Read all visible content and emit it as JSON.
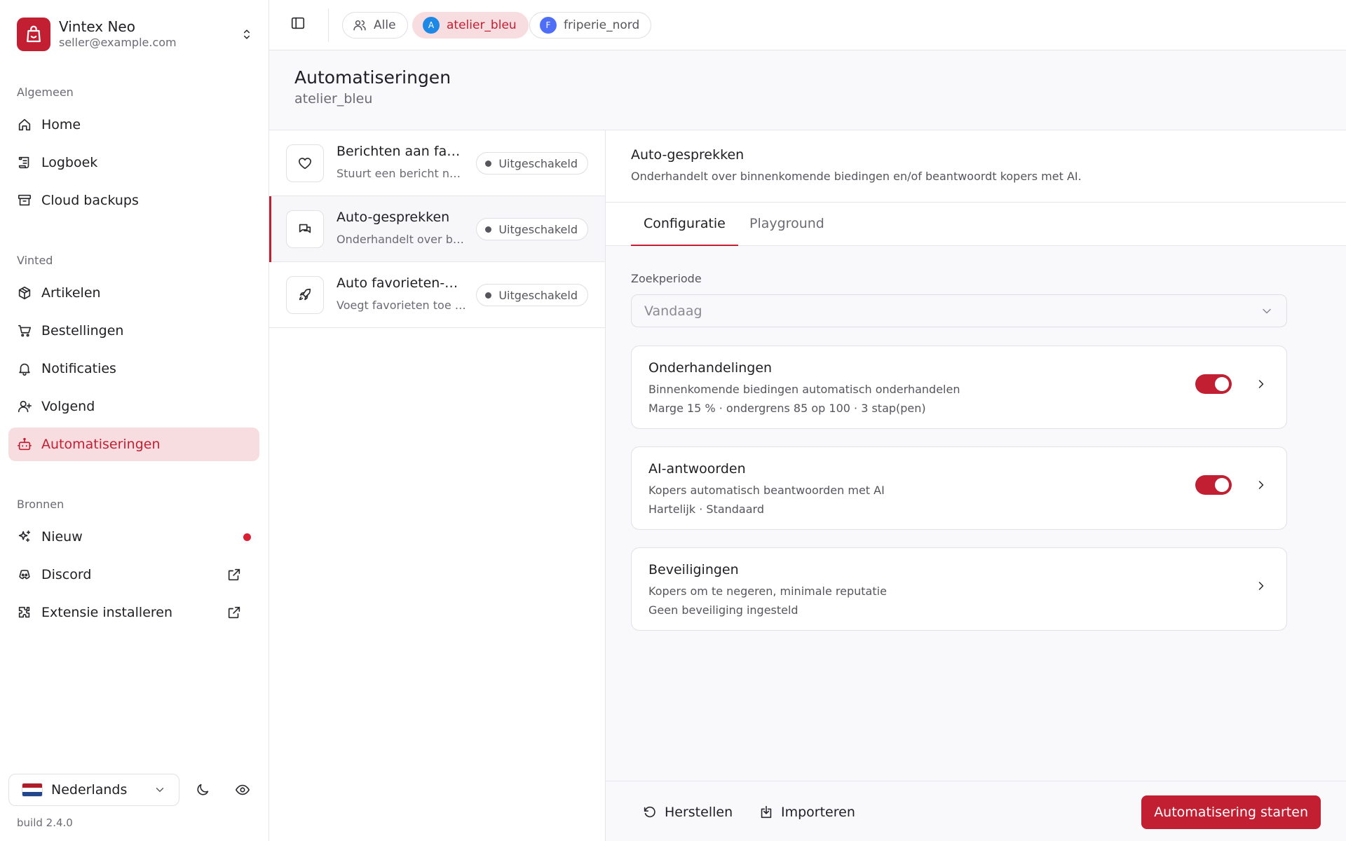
{
  "user": {
    "name": "Vintex Neo",
    "email": "seller@example.com"
  },
  "sidebar": {
    "sections": [
      {
        "title": "Algemeen",
        "items": [
          {
            "label": "Home"
          },
          {
            "label": "Logboek"
          },
          {
            "label": "Cloud backups"
          }
        ]
      },
      {
        "title": "Vinted",
        "items": [
          {
            "label": "Artikelen"
          },
          {
            "label": "Bestellingen"
          },
          {
            "label": "Notificaties"
          },
          {
            "label": "Volgend"
          },
          {
            "label": "Automatiseringen"
          }
        ]
      },
      {
        "title": "Bronnen",
        "items": [
          {
            "label": "Nieuw"
          },
          {
            "label": "Discord"
          },
          {
            "label": "Extensie installeren"
          }
        ]
      }
    ],
    "active_item": "Automatiseringen",
    "language": "Nederlands",
    "build": "build 2.4.0"
  },
  "topbar": {
    "chips": [
      {
        "label": "Alle"
      },
      {
        "label": "atelier_bleu",
        "avatar": "A",
        "avatar_color": "#1e88e5",
        "active": true
      },
      {
        "label": "friperie_nord",
        "avatar": "F",
        "avatar_color": "#4f6ef7"
      }
    ]
  },
  "header": {
    "title": "Automatiseringen",
    "subtitle": "atelier_bleu"
  },
  "automations": [
    {
      "title": "Berichten aan favorieten",
      "desc": "Stuurt een bericht naar gebruikers die een artikel favoriet maken",
      "status": "Uitgeschakeld",
      "icon": "heart-icon"
    },
    {
      "title": "Auto-gesprekken",
      "desc": "Onderhandelt over binnenkomende biedingen",
      "status": "Uitgeschakeld",
      "icon": "chat-icon",
      "selected": true
    },
    {
      "title": "Auto favorieten-boost",
      "desc": "Voegt favorieten toe aan artikelen",
      "status": "Uitgeschakeld",
      "icon": "rocket-icon"
    }
  ],
  "detail": {
    "title": "Auto-gesprekken",
    "desc": "Onderhandelt over binnenkomende biedingen en/of beantwoordt kopers met AI.",
    "tabs": [
      {
        "label": "Configuratie",
        "active": true
      },
      {
        "label": "Playground"
      }
    ],
    "period_label": "Zoekperiode",
    "period_value": "Vandaag",
    "cards": [
      {
        "title": "Onderhandelingen",
        "desc": "Binnenkomende biedingen automatisch onderhandelen",
        "meta": "Marge 15 % · ondergrens 85 op 100 · 3 stap(pen)",
        "enabled": true
      },
      {
        "title": "AI-antwoorden",
        "desc": "Kopers automatisch beantwoorden met AI",
        "meta": "Hartelijk · Standaard",
        "enabled": true
      },
      {
        "title": "Beveiligingen",
        "desc": "Kopers om te negeren, minimale reputatie",
        "meta": "Geen beveiliging ingesteld"
      }
    ]
  },
  "footer": {
    "reset_label": "Herstellen",
    "import_label": "Importeren",
    "start_label": "Automatisering starten"
  },
  "colors": {
    "accent": "#c21f33",
    "accent_soft": "#f8dde0"
  }
}
